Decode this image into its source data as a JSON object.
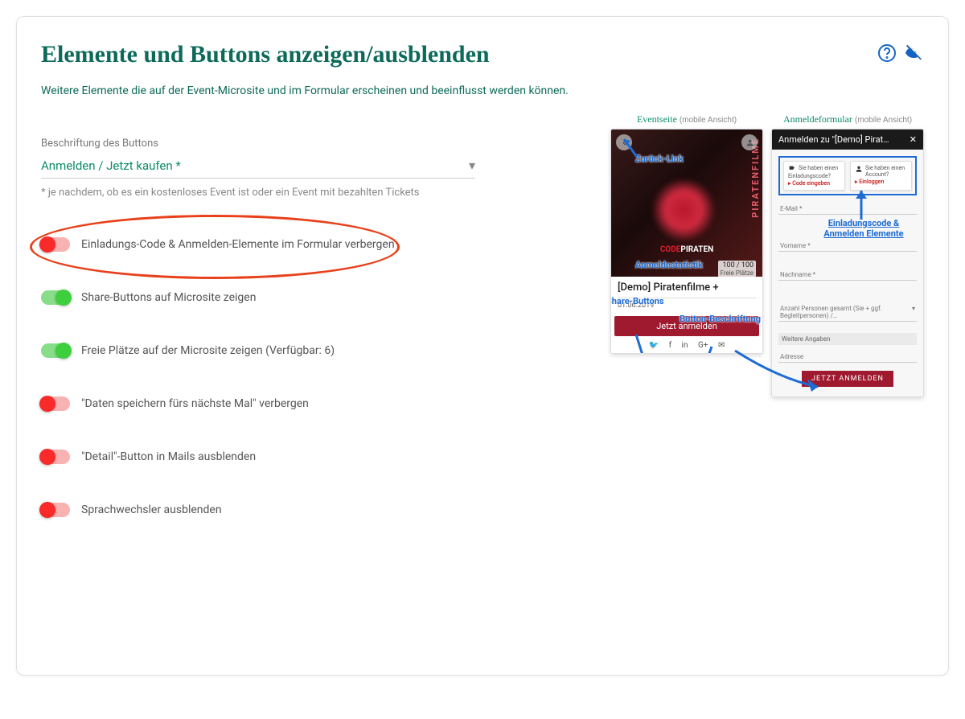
{
  "header": {
    "title": "Elemente und Buttons anzeigen/ausblenden",
    "subtitle": "Weitere Elemente die auf der Event-Microsite und im Formular erscheinen und beeinflusst werden können."
  },
  "dropdown": {
    "label": "Beschriftung des Buttons",
    "value": "Anmelden / Jetzt kaufen *",
    "helper": "* je nachdem, ob es ein kostenloses Event ist oder ein Event mit bezahlten Tickets"
  },
  "toggles": [
    {
      "state": "off",
      "label": "Einladungs-Code & Anmelden-Elemente im Formular verbergen",
      "highlighted": true
    },
    {
      "state": "on",
      "label": "Share-Buttons auf Microsite zeigen"
    },
    {
      "state": "on",
      "label": "Freie Plätze auf der Microsite zeigen (Verfügbar: 6)"
    },
    {
      "state": "off",
      "label": "\"Daten speichern fürs nächste Mal\" verbergen"
    },
    {
      "state": "off",
      "label": "\"Detail\"-Button in Mails ausblenden"
    },
    {
      "state": "off",
      "label": "Sprachwechsler ausblenden"
    }
  ],
  "previews": {
    "page": {
      "heading": "Eventseite",
      "heading_sub": "(mobile Ansicht)",
      "sideText": "PIRATENFILME",
      "imageLabelRed": "CODE",
      "imageLabelWhite": "PIRATEN",
      "annotations": {
        "back": "Zurück-Link",
        "stats": "Anmeldestatistik",
        "share": "Share-Buttons",
        "btn": "Button-Beschriftung"
      },
      "eventTitle": "[Demo] Piratenfilme +",
      "date": "01.06.2019",
      "stat": "100 / 100",
      "statLabel": "Freie Plätze",
      "cta": "Jetzt anmelden"
    },
    "form": {
      "heading": "Anmeldeformular",
      "heading_sub": "(mobile Ansicht)",
      "topbar": "Anmelden zu \"[Demo] Pirat…",
      "box1_q": "Sie haben einen Einladungscode?",
      "box1_a": "▸ Code eingeben",
      "box2_q": "Sie haben einen Account?",
      "box2_a": "▸ Einloggen",
      "annotation": "Einladungscode & Anmelden Elemente",
      "fields": {
        "email": "E-Mail *",
        "firstname": "Vorname *",
        "lastname": "Nachname *",
        "persons": "Anzahl Personen gesamt (Sie + ggf. Begleitpersonen) /…"
      },
      "section": "Weitere Angaben",
      "address": "Adresse",
      "submit": "JETZT ANMELDEN"
    }
  }
}
